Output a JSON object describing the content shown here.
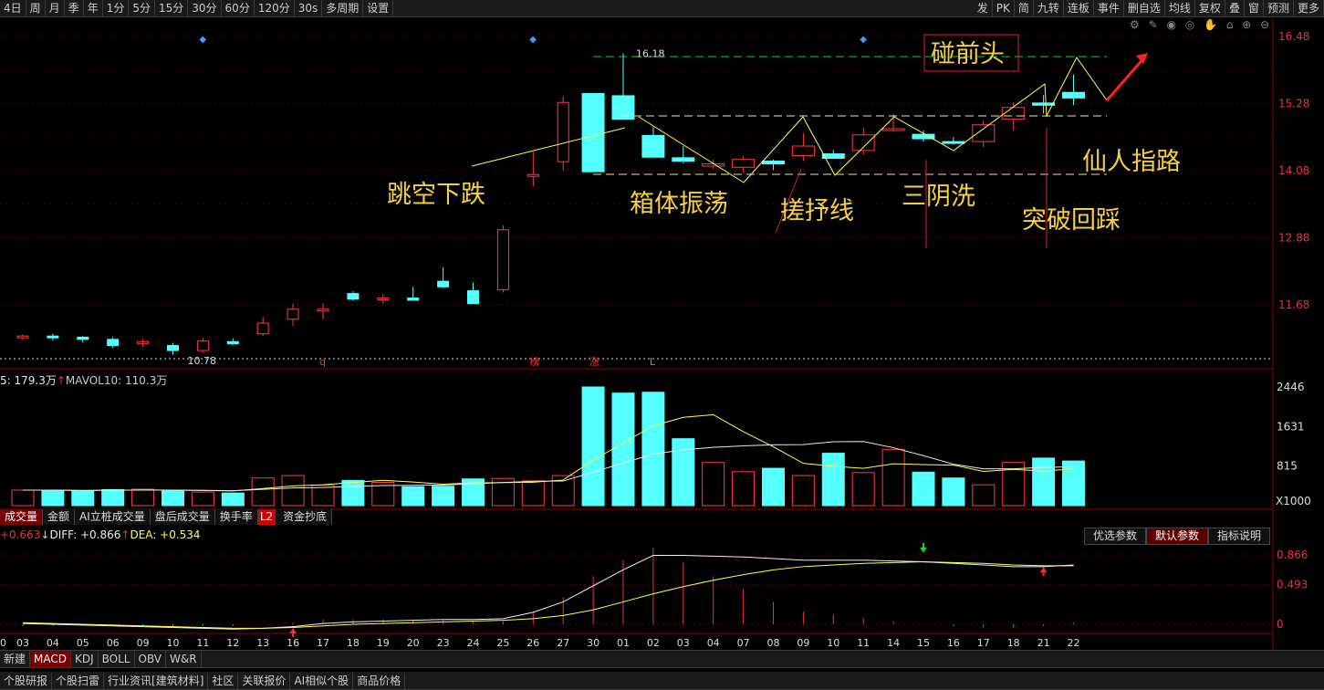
{
  "toolbar": {
    "periods": [
      "4日",
      "周",
      "月",
      "季",
      "年",
      "1分",
      "5分",
      "15分",
      "30分",
      "60分",
      "120分",
      "30s",
      "多周期",
      "设置"
    ],
    "right": [
      "发",
      "PK",
      "简",
      "九转",
      "连板",
      "事件",
      "删自选",
      "均线",
      "复权",
      "叠",
      "窗",
      "预测",
      "更多"
    ]
  },
  "tool_icons": "⚙ ✎ ◉ ◎ ✋ ⌂ ⊕ ⊖",
  "price_panel": {
    "y_ticks": [
      "16.48",
      "15.28",
      "14.08",
      "12.88",
      "11.68"
    ],
    "high_label": "16.18",
    "low_label": "10.78",
    "markers": [
      "q",
      "榜",
      "涨",
      "L"
    ]
  },
  "volume_panel": {
    "legend": "5: 179.3万",
    "legend2": "MAVOL10: 110.3万",
    "y_ticks": [
      "2446",
      "1631",
      "815"
    ],
    "unit": "X1000"
  },
  "volume_tabs": [
    "成交量",
    "金额",
    "AI立桩成交量",
    "盘后成交量",
    "换手率",
    "资金抄底"
  ],
  "l2_badge": "L2",
  "param_tabs": [
    "优选参数",
    "默认参数",
    "指标说明"
  ],
  "macd_panel": {
    "macd_label": "+0.663",
    "diff_label": "DIFF: +0.866",
    "dea_label": "DEA: +0.534",
    "y_ticks": [
      "0.866",
      "0.493",
      "0"
    ]
  },
  "x_axis_labels": [
    "03",
    "04",
    "05",
    "06",
    "09",
    "10",
    "11",
    "12",
    "13",
    "16",
    "17",
    "18",
    "19",
    "20",
    "23",
    "24",
    "25",
    "26",
    "27",
    "30",
    "01",
    "02",
    "03",
    "04",
    "07",
    "08",
    "09",
    "10",
    "11",
    "14",
    "15",
    "16",
    "17",
    "18",
    "21",
    "22"
  ],
  "first_x_label": "0",
  "indicator_tabs": [
    "新建",
    "MACD",
    "KDJ",
    "BOLL",
    "OBV",
    "W&R"
  ],
  "bottom_tabs": [
    "个股研报",
    "个股扫雷",
    "行业资讯[建筑材料]",
    "社区",
    "关联报价",
    "AI相似个股",
    "商品价格"
  ],
  "annotations": {
    "gap_down": "跳空下跌",
    "box": "箱体振荡",
    "twist": "搓抒线",
    "three_yin": "三阴洗",
    "breakout": "突破回踩",
    "touch_head": "碰前头",
    "path": "仙人指路"
  },
  "colors": {
    "up": "#ff3c3c",
    "down": "#54ffff",
    "ma_white": "#e8e8e8",
    "ma_yellow": "#ffff50",
    "annotation": "#f5d142",
    "box_line": "#e8e8a0",
    "green_ma": "#22cc22"
  },
  "chart_data": {
    "type": "candlestick",
    "dates": [
      "03",
      "04",
      "05",
      "06",
      "09",
      "10",
      "11",
      "12",
      "13",
      "16",
      "17",
      "18",
      "19",
      "20",
      "23",
      "24",
      "25",
      "26",
      "27",
      "30",
      "01",
      "02",
      "03",
      "04",
      "07",
      "08",
      "09",
      "10",
      "11",
      "14",
      "15",
      "16",
      "17",
      "18",
      "21",
      "22"
    ],
    "ohlc": [
      [
        11.1,
        11.15,
        11.05,
        11.12
      ],
      [
        11.12,
        11.16,
        11.04,
        11.1
      ],
      [
        11.1,
        11.12,
        11.0,
        11.06
      ],
      [
        11.06,
        11.1,
        10.9,
        10.95
      ],
      [
        11.0,
        11.06,
        10.92,
        11.02
      ],
      [
        10.95,
        11.0,
        10.78,
        10.86
      ],
      [
        10.86,
        11.08,
        10.82,
        11.03
      ],
      [
        11.02,
        11.08,
        10.96,
        10.98
      ],
      [
        11.16,
        11.46,
        11.12,
        11.35
      ],
      [
        11.42,
        11.7,
        11.3,
        11.6
      ],
      [
        11.6,
        11.7,
        11.42,
        11.6
      ],
      [
        11.88,
        11.92,
        11.75,
        11.78
      ],
      [
        11.78,
        11.87,
        11.7,
        11.8
      ],
      [
        11.8,
        12.0,
        11.78,
        11.76
      ],
      [
        12.1,
        12.35,
        11.98,
        12.0
      ],
      [
        11.93,
        12.08,
        11.86,
        11.7
      ],
      [
        11.95,
        13.1,
        11.9,
        13.02
      ],
      [
        14.0,
        14.42,
        13.8,
        14.01
      ],
      [
        14.24,
        15.41,
        14.08,
        15.3
      ],
      [
        15.46,
        15.46,
        14.06,
        14.06
      ],
      [
        15.42,
        16.18,
        15.0,
        15.0
      ],
      [
        14.71,
        14.86,
        14.33,
        14.32
      ],
      [
        14.31,
        14.52,
        14.21,
        14.25
      ],
      [
        14.16,
        14.28,
        14.11,
        14.2
      ],
      [
        14.14,
        14.34,
        14.05,
        14.28
      ],
      [
        14.25,
        14.28,
        14.09,
        14.2
      ],
      [
        14.35,
        14.75,
        14.25,
        14.52
      ],
      [
        14.38,
        14.45,
        14.3,
        14.3
      ],
      [
        14.44,
        14.85,
        14.36,
        14.72
      ],
      [
        14.82,
        15.1,
        14.78,
        14.83
      ],
      [
        14.73,
        14.8,
        14.6,
        14.65
      ],
      [
        14.6,
        14.68,
        14.55,
        14.58
      ],
      [
        14.6,
        14.98,
        14.5,
        14.9
      ],
      [
        15.0,
        15.3,
        14.8,
        15.21
      ],
      [
        15.29,
        15.43,
        15.1,
        15.25
      ],
      [
        15.48,
        15.8,
        15.25,
        15.38
      ]
    ],
    "volume": [
      320,
      320,
      300,
      330,
      340,
      310,
      280,
      260,
      570,
      620,
      420,
      520,
      480,
      390,
      400,
      550,
      560,
      510,
      620,
      2446,
      2320,
      2338,
      1380,
      890,
      700,
      770,
      620,
      1080,
      680,
      1160,
      690,
      570,
      430,
      890,
      980,
      920,
      1110
    ],
    "y_range": [
      10.6,
      16.48
    ],
    "macd": {
      "diff": [
        0.01,
        0.0,
        -0.01,
        -0.02,
        -0.03,
        -0.04,
        -0.05,
        -0.06,
        -0.05,
        -0.03,
        0.01,
        0.03,
        0.04,
        0.05,
        0.06,
        0.06,
        0.07,
        0.15,
        0.28,
        0.48,
        0.68,
        0.86,
        0.86,
        0.85,
        0.84,
        0.82,
        0.8,
        0.8,
        0.8,
        0.79,
        0.78,
        0.76,
        0.74,
        0.72,
        0.72,
        0.74,
        0.75
      ],
      "dea": [
        0.02,
        0.01,
        0.0,
        -0.01,
        -0.02,
        -0.03,
        -0.04,
        -0.05,
        -0.05,
        -0.04,
        -0.02,
        0.0,
        0.01,
        0.02,
        0.03,
        0.04,
        0.05,
        0.07,
        0.11,
        0.18,
        0.28,
        0.38,
        0.47,
        0.55,
        0.62,
        0.68,
        0.72,
        0.74,
        0.76,
        0.77,
        0.78,
        0.77,
        0.76,
        0.74,
        0.73,
        0.73,
        0.74
      ],
      "y_range": [
        -0.05,
        0.95
      ]
    }
  }
}
